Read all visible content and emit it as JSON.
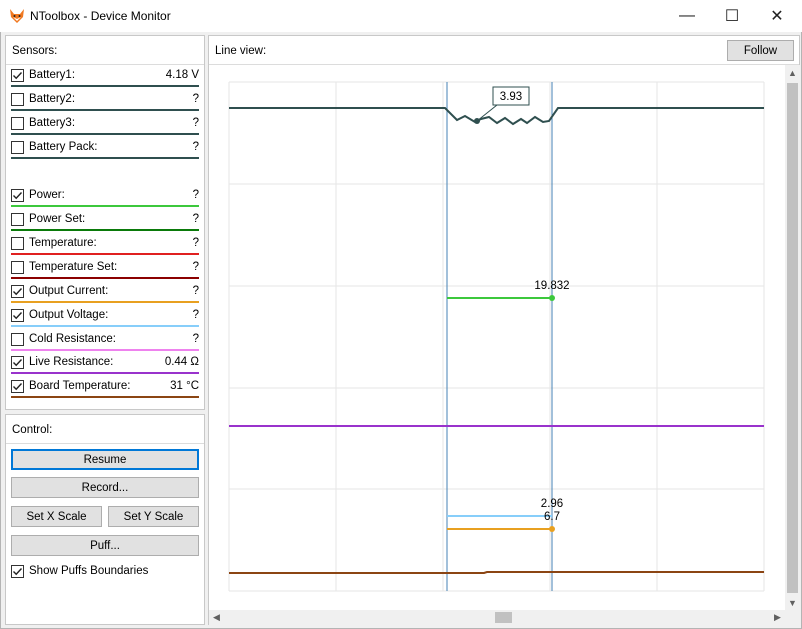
{
  "window": {
    "title": "NToolbox - Device Monitor",
    "minimize_glyph": "—",
    "maximize_glyph": "☐",
    "close_glyph": "✕"
  },
  "sensors": {
    "header": "Sensors:",
    "items": [
      {
        "label": "Battery1:",
        "value": "4.18 V",
        "checked": true,
        "color": "#2f4f4f"
      },
      {
        "label": "Battery2:",
        "value": "?",
        "checked": false,
        "color": "#2f4f4f"
      },
      {
        "label": "Battery3:",
        "value": "?",
        "checked": false,
        "color": "#2f4f4f"
      },
      {
        "label": "Battery Pack:",
        "value": "?",
        "checked": false,
        "color": "#2f4f4f"
      },
      {
        "label": "Power:",
        "value": "?",
        "checked": true,
        "color": "#3cc83c"
      },
      {
        "label": "Power Set:",
        "value": "?",
        "checked": false,
        "color": "#0a7a0a"
      },
      {
        "label": "Temperature:",
        "value": "?",
        "checked": false,
        "color": "#e02020"
      },
      {
        "label": "Temperature Set:",
        "value": "?",
        "checked": false,
        "color": "#8b0000"
      },
      {
        "label": "Output Current:",
        "value": "?",
        "checked": true,
        "color": "#e8a020"
      },
      {
        "label": "Output Voltage:",
        "value": "?",
        "checked": true,
        "color": "#87cefa"
      },
      {
        "label": "Cold Resistance:",
        "value": "?",
        "checked": false,
        "color": "#ee82ee"
      },
      {
        "label": "Live Resistance:",
        "value": "0.44 Ω",
        "checked": true,
        "color": "#9932cc"
      },
      {
        "label": "Board Temperature:",
        "value": "31 °C",
        "checked": true,
        "color": "#8b4513"
      }
    ]
  },
  "control": {
    "header": "Control:",
    "resume": "Resume",
    "record": "Record...",
    "set_x_scale": "Set X Scale",
    "set_y_scale": "Set Y Scale",
    "puff": "Puff...",
    "show_puffs_boundaries": "Show Puffs Boundaries",
    "show_puffs_checked": true
  },
  "line_view": {
    "header": "Line view:",
    "follow": "Follow",
    "annotations": {
      "battery": "3.93",
      "power": "19.832",
      "voltage": "2.96",
      "current": "6.7"
    },
    "colors": {
      "battery": "#2f4f4f",
      "power": "#3cc83c",
      "resistance": "#9932cc",
      "voltage": "#87cefa",
      "current": "#e8a020",
      "board_temp": "#8b4513",
      "boundary": "#4682b4",
      "grid": "#e6e6e6"
    }
  }
}
